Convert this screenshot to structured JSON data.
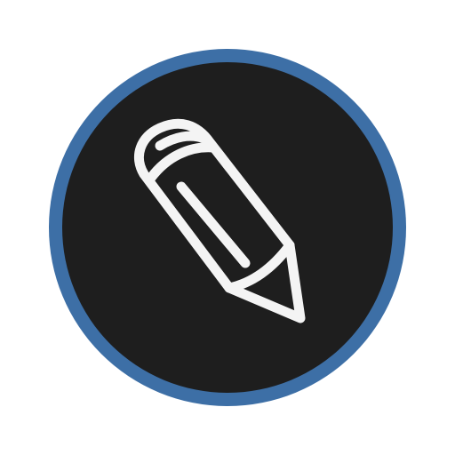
{
  "icon": {
    "name": "pencil-icon",
    "colors": {
      "background": "#ffffff",
      "ring": "#3d6fa6",
      "disc": "#1e1e1e",
      "glyph": "#f4f4f4"
    }
  }
}
